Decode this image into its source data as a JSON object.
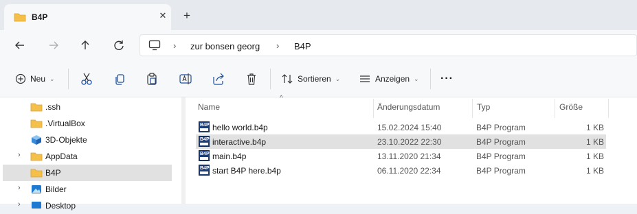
{
  "tab": {
    "title": "B4P",
    "close": "✕",
    "new_tab": "+"
  },
  "breadcrumb": {
    "items": [
      "zur bonsen georg",
      "B4P"
    ],
    "separator": "›"
  },
  "toolbar": {
    "new_label": "Neu",
    "sort_label": "Sortieren",
    "view_label": "Anzeigen",
    "more_label": "···"
  },
  "sidebar": {
    "items": [
      {
        "label": ".ssh",
        "icon": "folder-icon",
        "expand": ""
      },
      {
        "label": ".VirtualBox",
        "icon": "folder-icon",
        "expand": ""
      },
      {
        "label": "3D-Objekte",
        "icon": "cube-icon",
        "expand": ""
      },
      {
        "label": "AppData",
        "icon": "folder-icon",
        "expand": "›"
      },
      {
        "label": "B4P",
        "icon": "folder-icon",
        "expand": "",
        "selected": true
      },
      {
        "label": "Bilder",
        "icon": "pictures-icon",
        "expand": "›"
      },
      {
        "label": "Desktop",
        "icon": "desktop-icon",
        "expand": "›"
      }
    ]
  },
  "columns": {
    "name": "Name",
    "date": "Änderungsdatum",
    "type": "Typ",
    "size": "Größe",
    "sort_indicator": "^"
  },
  "files": [
    {
      "name": "hello world.b4p",
      "date": "15.02.2024 15:40",
      "type": "B4P Program",
      "size": "1 KB",
      "icon_text": "B4P"
    },
    {
      "name": "interactive.b4p",
      "date": "23.10.2022 22:30",
      "type": "B4P Program",
      "size": "1 KB",
      "icon_text": "B4P",
      "selected": true
    },
    {
      "name": "main.b4p",
      "date": "13.11.2020 21:34",
      "type": "B4P Program",
      "size": "1 KB",
      "icon_text": "B4P"
    },
    {
      "name": "start B4P here.b4p",
      "date": "06.11.2020 22:34",
      "type": "B4P Program",
      "size": "1 KB",
      "icon_text": "B4P"
    }
  ],
  "colors": {
    "folder": "#f5c04a",
    "selection": "#e1e1e1",
    "file_icon": "#1c3d78",
    "accent": "#0067c0"
  }
}
